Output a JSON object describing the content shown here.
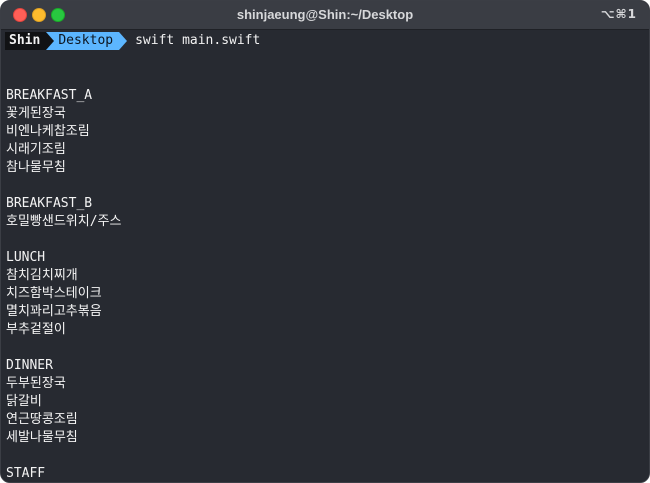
{
  "window": {
    "title": "shinjaeung@Shin:~/Desktop",
    "shortcut": "⌥⌘1"
  },
  "prompt": {
    "user": "Shin",
    "directory": "Desktop",
    "command": "swift main.swift"
  },
  "output": [
    "BREAKFAST_A",
    "꽃게된장국",
    "비엔나케찹조림",
    "시래기조림",
    "참나물무침",
    "",
    "BREAKFAST_B",
    "호밀빵샌드위치/주스",
    "",
    "LUNCH",
    "참치김치찌개",
    "치즈함박스테이크",
    "멸치꽈리고추볶음",
    "부추겉절이",
    "",
    "DINNER",
    "두부된장국",
    "닭갈비",
    "연근땅콩조림",
    "세발나물무침",
    "",
    "STAFF"
  ],
  "colors": {
    "terminal_bg": "#272a31",
    "titlebar_bg": "#3a3d44",
    "prompt_user_bg": "#111214",
    "prompt_dir_bg": "#5cb6ff",
    "text": "#f2f2f2"
  }
}
